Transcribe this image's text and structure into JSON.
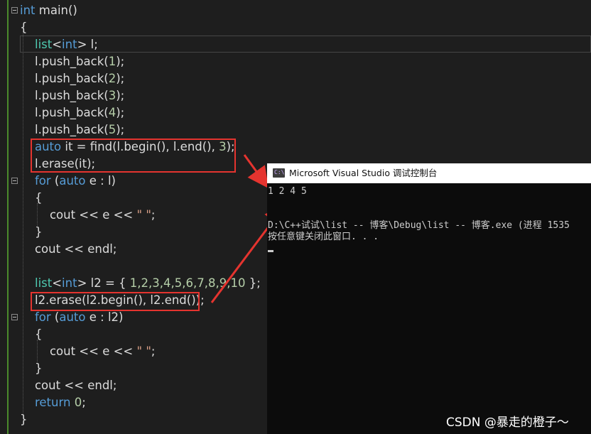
{
  "editor": {
    "lines": [
      {
        "segments": [
          {
            "t": "int",
            "c": "kw"
          },
          {
            "t": " main()",
            "c": ""
          }
        ]
      },
      {
        "segments": [
          {
            "t": "{",
            "c": ""
          }
        ]
      },
      {
        "segments": [
          {
            "t": "    ",
            "c": ""
          },
          {
            "t": "list",
            "c": "ty"
          },
          {
            "t": "<",
            "c": ""
          },
          {
            "t": "int",
            "c": "kw"
          },
          {
            "t": "> l;",
            "c": ""
          }
        ]
      },
      {
        "segments": [
          {
            "t": "    l.push_back(",
            "c": ""
          },
          {
            "t": "1",
            "c": "num"
          },
          {
            "t": ");",
            "c": ""
          }
        ]
      },
      {
        "segments": [
          {
            "t": "    l.push_back(",
            "c": ""
          },
          {
            "t": "2",
            "c": "num"
          },
          {
            "t": ");",
            "c": ""
          }
        ]
      },
      {
        "segments": [
          {
            "t": "    l.push_back(",
            "c": ""
          },
          {
            "t": "3",
            "c": "num"
          },
          {
            "t": ");",
            "c": ""
          }
        ]
      },
      {
        "segments": [
          {
            "t": "    l.push_back(",
            "c": ""
          },
          {
            "t": "4",
            "c": "num"
          },
          {
            "t": ");",
            "c": ""
          }
        ]
      },
      {
        "segments": [
          {
            "t": "    l.push_back(",
            "c": ""
          },
          {
            "t": "5",
            "c": "num"
          },
          {
            "t": ");",
            "c": ""
          }
        ]
      },
      {
        "segments": [
          {
            "t": "    ",
            "c": ""
          },
          {
            "t": "auto",
            "c": "kw"
          },
          {
            "t": " it = find(l.begin(), l.end(), ",
            "c": ""
          },
          {
            "t": "3",
            "c": "num"
          },
          {
            "t": ");",
            "c": ""
          }
        ]
      },
      {
        "segments": [
          {
            "t": "    l.erase(it);",
            "c": ""
          }
        ]
      },
      {
        "segments": [
          {
            "t": "    ",
            "c": ""
          },
          {
            "t": "for",
            "c": "kw"
          },
          {
            "t": " (",
            "c": ""
          },
          {
            "t": "auto",
            "c": "kw"
          },
          {
            "t": " e : l)",
            "c": ""
          }
        ]
      },
      {
        "segments": [
          {
            "t": "    {",
            "c": ""
          }
        ]
      },
      {
        "segments": [
          {
            "t": "        cout << e << ",
            "c": ""
          },
          {
            "t": "\" \"",
            "c": "st"
          },
          {
            "t": ";",
            "c": ""
          }
        ]
      },
      {
        "segments": [
          {
            "t": "    }",
            "c": ""
          }
        ]
      },
      {
        "segments": [
          {
            "t": "    cout << endl;",
            "c": ""
          }
        ]
      },
      {
        "segments": [
          {
            "t": "",
            "c": ""
          }
        ]
      },
      {
        "segments": [
          {
            "t": "    ",
            "c": ""
          },
          {
            "t": "list",
            "c": "ty"
          },
          {
            "t": "<",
            "c": ""
          },
          {
            "t": "int",
            "c": "kw"
          },
          {
            "t": "> l2 = { ",
            "c": ""
          },
          {
            "t": "1,2,3,4,5,6,7,8,9,10",
            "c": "num"
          },
          {
            "t": " };",
            "c": ""
          }
        ]
      },
      {
        "segments": [
          {
            "t": "    l2.erase(l2.begin(), l2.end());",
            "c": ""
          }
        ]
      },
      {
        "segments": [
          {
            "t": "    ",
            "c": ""
          },
          {
            "t": "for",
            "c": "kw"
          },
          {
            "t": " (",
            "c": ""
          },
          {
            "t": "auto",
            "c": "kw"
          },
          {
            "t": " e : l2)",
            "c": ""
          }
        ]
      },
      {
        "segments": [
          {
            "t": "    {",
            "c": ""
          }
        ]
      },
      {
        "segments": [
          {
            "t": "        cout << e << ",
            "c": ""
          },
          {
            "t": "\" \"",
            "c": "st"
          },
          {
            "t": ";",
            "c": ""
          }
        ]
      },
      {
        "segments": [
          {
            "t": "    }",
            "c": ""
          }
        ]
      },
      {
        "segments": [
          {
            "t": "    cout << endl;",
            "c": ""
          }
        ]
      },
      {
        "segments": [
          {
            "t": "    ",
            "c": ""
          },
          {
            "t": "return",
            "c": "kw"
          },
          {
            "t": " ",
            "c": ""
          },
          {
            "t": "0",
            "c": "num"
          },
          {
            "t": ";",
            "c": ""
          }
        ]
      },
      {
        "segments": [
          {
            "t": "}",
            "c": ""
          }
        ]
      }
    ]
  },
  "console": {
    "title": "Microsoft Visual Studio 调试控制台",
    "icon_label": "C:\\",
    "output_line1": "1 2 4 5",
    "output_line2": "D:\\C++试试\\list -- 博客\\Debug\\list -- 博客.exe (进程 1535",
    "output_line3": "按任意键关闭此窗口. . ."
  },
  "watermark": "CSDN @暴走的橙子～",
  "colors": {
    "background": "#1e1e1e",
    "keyword": "#569cd6",
    "type": "#4ec9b0",
    "number": "#b5cea8",
    "string": "#d69d85",
    "highlight_box": "#e5342f",
    "console_bg": "#0c0c0c"
  }
}
